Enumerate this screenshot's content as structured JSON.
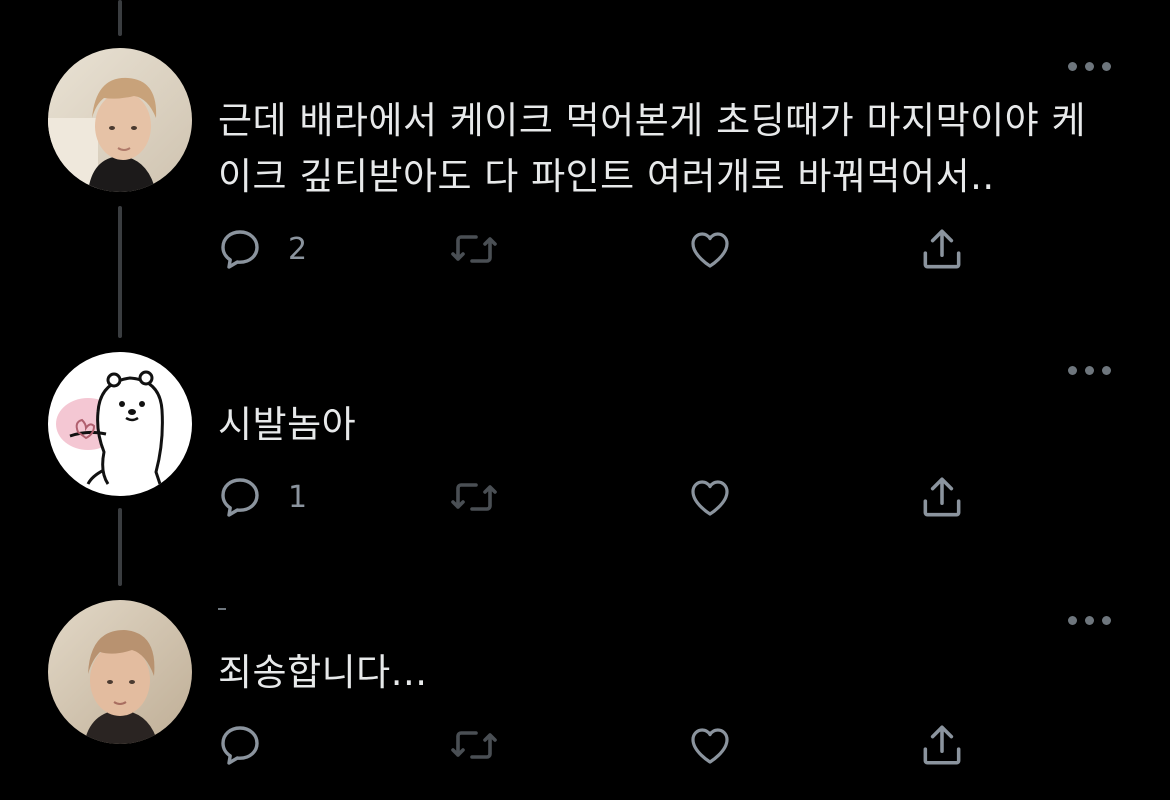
{
  "thread": {
    "tweets": [
      {
        "text": "근데 배라에서 케이크 먹어본게 초딩때가 마지막이야 케\n이크 깊티받아도 다 파인트 여러개로 바꿔먹어서..",
        "reply_count": "2",
        "avatar": "person-photo"
      },
      {
        "text": "시발놈아",
        "reply_count": "1",
        "avatar": "white-bear-heart"
      },
      {
        "text": "죄송합니다...",
        "reply_count": "",
        "avatar": "person-photo"
      }
    ]
  },
  "icons": {
    "reply": "reply-icon",
    "retweet": "retweet-icon",
    "like": "heart-icon",
    "share": "share-icon",
    "more": "more-options-icon"
  },
  "colors": {
    "background": "#000000",
    "text": "#e7e9ea",
    "icon": "#8b949e",
    "thread_line": "#3a3d40"
  }
}
